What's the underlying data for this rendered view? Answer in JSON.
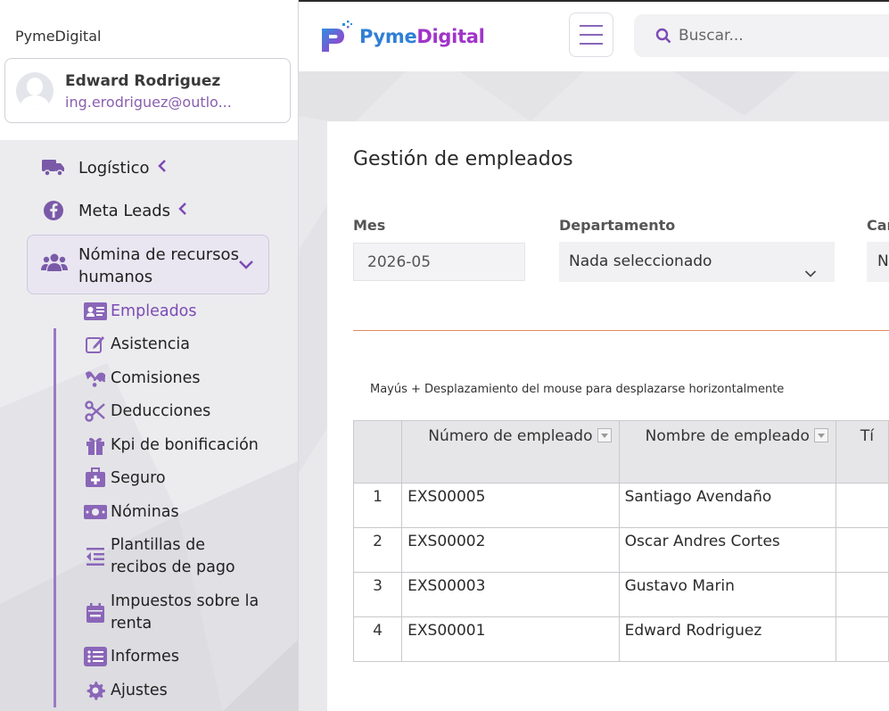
{
  "sidebar": {
    "brand": "PymeDigital",
    "user": {
      "name": "Edward Rodriguez",
      "email": "ing.erodriguez@outlo..."
    },
    "menu": [
      {
        "label": "Logístico",
        "icon": "truck-icon"
      },
      {
        "label": "Meta Leads",
        "icon": "facebook-icon"
      }
    ],
    "nomina": {
      "label": "Nómina de recursos humanos",
      "icon": "users-icon"
    },
    "submenu": [
      {
        "label": "Empleados",
        "icon": "id-card-icon",
        "active": true
      },
      {
        "label": "Asistencia",
        "icon": "edit-icon"
      },
      {
        "label": "Comisiones",
        "icon": "handshake-icon"
      },
      {
        "label": "Deducciones",
        "icon": "scissors-icon"
      },
      {
        "label": "Kpi de bonificación",
        "icon": "gift-icon"
      },
      {
        "label": "Seguro",
        "icon": "medkit-icon"
      },
      {
        "label": "Nóminas",
        "icon": "money-icon"
      },
      {
        "label": "Plantillas de recibos de pago",
        "icon": "outdent-icon"
      },
      {
        "label": "Impuestos sobre la renta",
        "icon": "calendar-icon"
      },
      {
        "label": "Informes",
        "icon": "list-icon"
      },
      {
        "label": "Ajustes",
        "icon": "gear-icon"
      }
    ]
  },
  "topbar": {
    "logo_part1": "Pyme",
    "logo_part2": "Digital",
    "search_placeholder": "Buscar..."
  },
  "main": {
    "title": "Gestión de empleados",
    "filters": {
      "month_label": "Mes",
      "month_value": "2026-05",
      "department_label": "Departamento",
      "department_value": "Nada seleccionado",
      "position_label": "Car",
      "position_value": "N"
    },
    "hint": "Mayús + Desplazamiento del mouse para desplazarse horizontalmente",
    "table": {
      "columns": [
        "Número de empleado",
        "Nombre de empleado",
        "Tí"
      ],
      "rows": [
        {
          "index": "1",
          "employee_number": "EXS00005",
          "employee_name": "Santiago Avendaño"
        },
        {
          "index": "2",
          "employee_number": "EXS00002",
          "employee_name": "Oscar Andres Cortes"
        },
        {
          "index": "3",
          "employee_number": "EXS00003",
          "employee_name": "Gustavo Marin"
        },
        {
          "index": "4",
          "employee_number": "EXS00001",
          "employee_name": "Edward Rodriguez"
        }
      ]
    }
  },
  "colors": {
    "accent": "#7b4bb5",
    "accent_light": "#9b79c4",
    "logo_blue": "#2f7fd6",
    "logo_purple": "#a034c9",
    "divider": "#e08a5e"
  }
}
